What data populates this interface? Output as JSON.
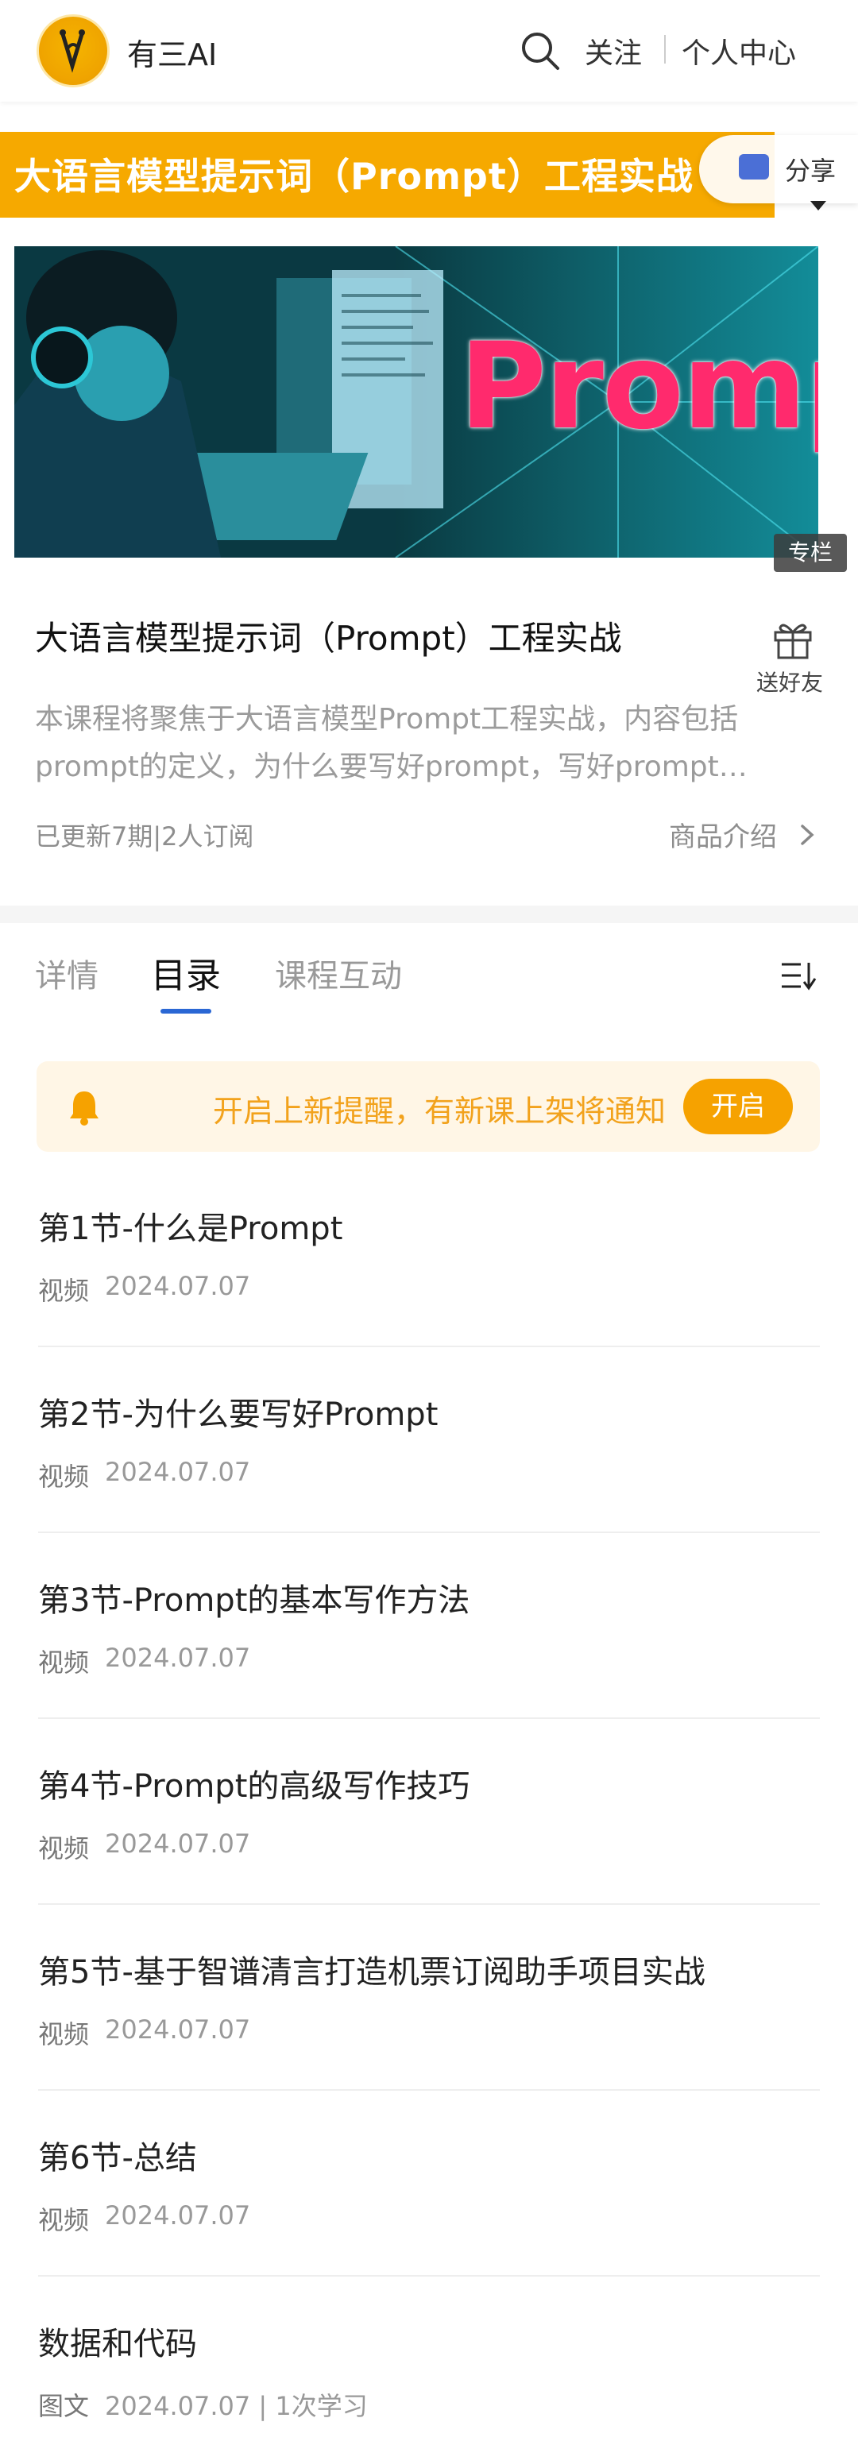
{
  "header": {
    "brand": "有三AI",
    "follow": "关注",
    "user_center": "个人中心"
  },
  "banner": {
    "text": "大语言模型提示词（Prompt）工程实战",
    "share": "分享"
  },
  "cover": {
    "word": "Prompt",
    "badge": "专栏"
  },
  "course": {
    "title": "大语言模型提示词（Prompt）工程实战",
    "gift_label": "送好友",
    "desc_line1": "本课程将聚焦于大语言模型Prompt工程实战，内容包括",
    "desc_line2": "prompt的定义，为什么要写好prompt，写好prompt…",
    "meta": "已更新7期|2人订阅",
    "intro": "商品介绍"
  },
  "tabs": {
    "details": "详情",
    "catalog": "目录",
    "interaction": "课程互动"
  },
  "reminder": {
    "text": "开启上新提醒，有新课上架将通知",
    "button": "开启"
  },
  "chapters": [
    {
      "title": "第1节-什么是Prompt",
      "type": "视频",
      "date": "2024.07.07"
    },
    {
      "title": "第2节-为什么要写好Prompt",
      "type": "视频",
      "date": "2024.07.07"
    },
    {
      "title": "第3节-Prompt的基本写作方法",
      "type": "视频",
      "date": "2024.07.07"
    },
    {
      "title": "第4节-Prompt的高级写作技巧",
      "type": "视频",
      "date": "2024.07.07"
    },
    {
      "title": "第5节-基于智谱清言打造机票订阅助手项目实战",
      "type": "视频",
      "date": "2024.07.07"
    },
    {
      "title": "第6节-总结",
      "type": "视频",
      "date": "2024.07.07"
    },
    {
      "title": "数据和代码",
      "type": "图文",
      "date": "2024.07.07 | 1次学习"
    }
  ],
  "colors": {
    "accent_orange": "#f6a900",
    "tab_blue": "#2a67d4"
  }
}
